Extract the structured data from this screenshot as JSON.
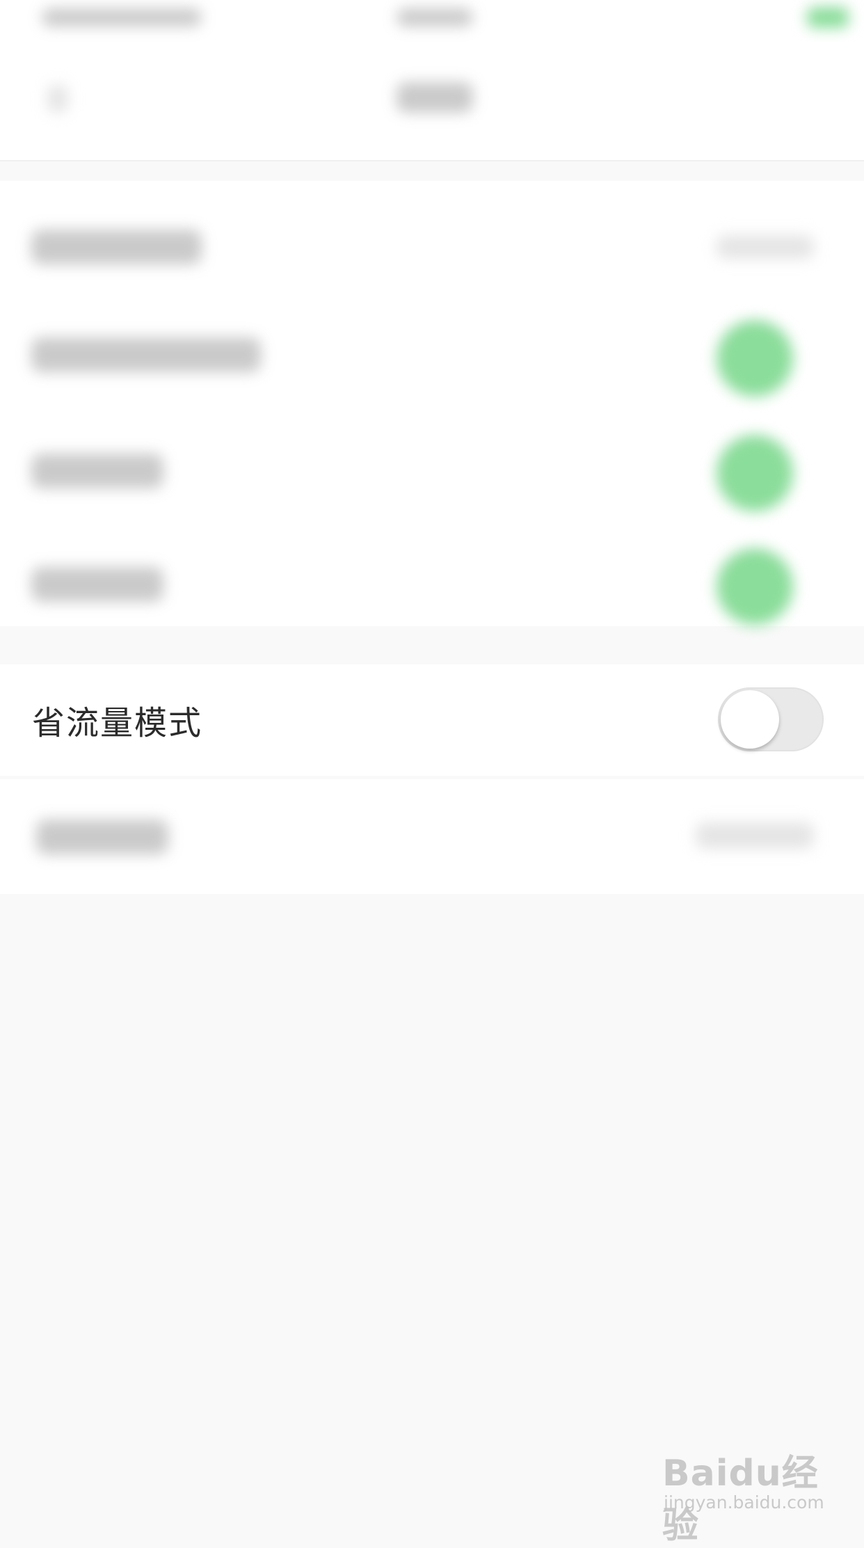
{
  "settings": {
    "data_saver": {
      "label": "省流量模式",
      "enabled": false
    }
  },
  "watermark": {
    "logo": "Baidu经验",
    "url": "jingyan.baidu.com"
  },
  "colors": {
    "page_background": "#f9f9f9",
    "row_background": "#ffffff",
    "blurred_toggle_on": "#8bdd9b",
    "toggle_off_track": "#e9e9e9"
  }
}
